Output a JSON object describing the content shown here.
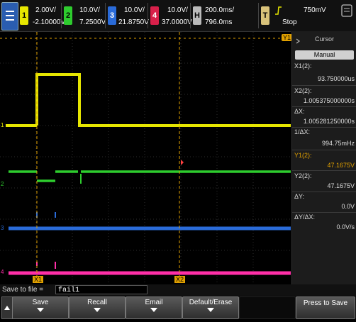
{
  "colors": {
    "ch1": "#e6e600",
    "ch2": "#2ecc2e",
    "ch3": "#2a6bd9",
    "ch4": "#ff2fa8",
    "marker": "#e0a000",
    "accent": "#2a5db0"
  },
  "header": {
    "ch1": {
      "num": "1",
      "scale": "2.00V/",
      "offset": "-2.10000V"
    },
    "ch2": {
      "num": "2",
      "scale": "10.0V/",
      "offset": "7.2500V"
    },
    "ch3": {
      "num": "3",
      "scale": "10.0V/",
      "offset": "21.8750V"
    },
    "ch4": {
      "num": "4",
      "scale": "10.0V/",
      "offset": "37.0000V"
    },
    "horiz": {
      "label": "H",
      "scale": "200.0ms/",
      "delay": "796.0ms"
    },
    "trigger": {
      "label": "T",
      "level": "750mV",
      "state": "Stop"
    }
  },
  "screen": {
    "markers": {
      "x1": "X1",
      "x2": "X2",
      "y1": "Y1"
    },
    "ch_labels": {
      "ch1": "1",
      "ch2": "2",
      "ch3": "3",
      "ch4": "4"
    }
  },
  "cursor_panel": {
    "title": "Cursor",
    "mode": "Manual",
    "x1_label": "X1(2):",
    "x1_value": "93.750000us",
    "x2_label": "X2(2):",
    "x2_value": "1.005375000000s",
    "dx_label": "ΔX:",
    "dx_value": "1.005281250000s",
    "inv_dx_label": "1/ΔX:",
    "inv_dx_value": "994.75mHz",
    "y1_label": "Y1(2):",
    "y1_value": "47.1675V",
    "y2_label": "Y2(2):",
    "y2_value": "47.1675V",
    "dy_label": "ΔY:",
    "dy_value": "0.0V",
    "dydx_label": "ΔY/ΔX:",
    "dydx_value": "0.0V/s"
  },
  "savebar": {
    "label": "Save to file =",
    "filename": "fail1"
  },
  "softkeys": {
    "save": "Save",
    "recall": "Recall",
    "email": "Email",
    "default_erase": "Default/Erase",
    "press_to_save": "Press to Save"
  }
}
